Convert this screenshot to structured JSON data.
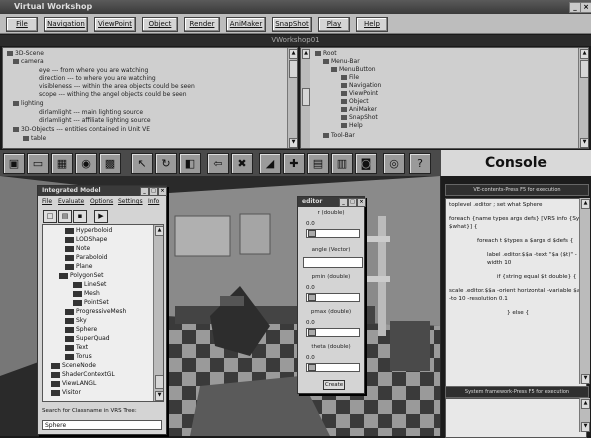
{
  "app": {
    "title": "Virtual Workshop",
    "subtitle": "VWorkshop01"
  },
  "window_controls": [
    "_",
    "×"
  ],
  "menu": [
    "File",
    "Navigation",
    "ViewPoint",
    "Object",
    "Render",
    "AniMaker",
    "SnapShot",
    "Play",
    "Help"
  ],
  "scene_tree": [
    "3D-Scene",
    "camera",
    "eye --- from where you are watching",
    "direction --- to where you are watching",
    "visibleness --- within the area objects could be seen",
    "scope --- withing the angel objects could be seen",
    "lighting",
    "dirlamlight --- main lighting source",
    "dirlamlight --- affiliate lighting source",
    "3D-Objects --- entities contained in Unit VE",
    "table"
  ],
  "ui_tree": [
    "Root",
    "Menu-Bar",
    "MenuButton",
    "File",
    "Navigation",
    "ViewPoint",
    "Object",
    "AniMaker",
    "SnapShot",
    "Help",
    "Tool-Bar"
  ],
  "toolbar_icons": [
    "camera-icon",
    "monitor-icon",
    "photo-icon",
    "globe-icon",
    "grid-icon",
    "cursor-icon",
    "rotate-icon",
    "cube-icon",
    "arrow-left-icon",
    "delete-icon",
    "brush-icon",
    "cross-icon",
    "film-icon",
    "image-icon",
    "camera2-icon",
    "disc-icon",
    "help-icon"
  ],
  "toolbar_glyphs": [
    "▣",
    "▭",
    "▦",
    "◉",
    "▩",
    "↖",
    "↻",
    "◧",
    "⇦",
    "✖",
    "◢",
    "✚",
    "▤",
    "▥",
    "◙",
    "◎",
    "?"
  ],
  "integrated": {
    "title": "Integrated Model",
    "menu": [
      "File",
      "Evaluate",
      "Options",
      "Settings",
      "Info"
    ],
    "buttons": [
      "□",
      "▤",
      "▪",
      "▶"
    ],
    "tree": [
      "Hyperboloid",
      "LODShape",
      "Note",
      "Paraboloid",
      "Plane",
      "PolygonSet",
      "LineSet",
      "Mesh",
      "PointSet",
      "ProgressiveMesh",
      "Sky",
      "Sphere",
      "SuperQuad",
      "Text",
      "Torus",
      "SceneNode",
      "ShaderContextGL",
      "ViewLANGL",
      "Visitor"
    ],
    "search_label": "Search for Classname in VRS Tree:",
    "search_value": "Sphere"
  },
  "editor": {
    "title": "editor",
    "fields": [
      {
        "label": "r (double)",
        "value": "0.0"
      },
      {
        "label": "angle (Vector)",
        "value": ""
      },
      {
        "label": "pmin (double)",
        "value": "0.0"
      },
      {
        "label": "pmax (double)",
        "value": "0.0"
      },
      {
        "label": "theta (double)",
        "value": "0.0"
      }
    ],
    "create_label": "Create"
  },
  "console": {
    "title": "Console",
    "top_header": "VE-contents-Press F5 for execution",
    "script": [
      "toplevel .editor ; set what Sphere",
      "foreach {name types args defs} [VRS info {Sys $what}] {",
      "foreach t $types a $args d $defs {",
      "label .editor.$$a -text \"$a ($t)\" -width 10",
      "if {string equal $t double} {",
      "scale .editor.$$a -orient horizontal -variable $a -to 10 -resolution 0.1",
      "} else {"
    ],
    "bottom_header": "System framework-Press F5 for execution"
  }
}
